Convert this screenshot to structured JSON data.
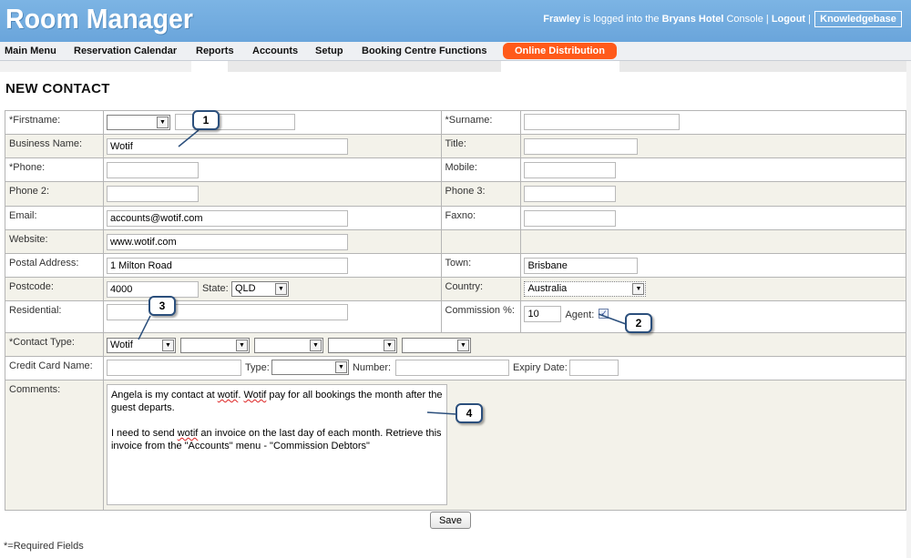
{
  "app": {
    "logo": "Room Manager",
    "user_name": "Frawley",
    "user_mid": " is logged into the ",
    "hotel_name": "Bryans Hotel",
    "user_tail": " Console | ",
    "logout": "Logout",
    "sep": " |",
    "knowledgebase": "Knowledgebase"
  },
  "nav": {
    "items": [
      "Main Menu",
      "Reservation Calendar",
      "Reports",
      "Accounts",
      "Setup",
      "Booking Centre Functions"
    ],
    "online": "Online Distribution"
  },
  "page": {
    "title": "NEW CONTACT"
  },
  "form": {
    "firstname_label": "*Firstname:",
    "surname_label": "*Surname:",
    "business_label": "Business Name:",
    "business_value": "Wotif",
    "title_label": "Title:",
    "phone_label": "*Phone:",
    "mobile_label": "Mobile:",
    "phone2_label": "Phone 2:",
    "phone3_label": "Phone 3:",
    "email_label": "Email:",
    "email_value": "accounts@wotif.com",
    "faxno_label": "Faxno:",
    "website_label": "Website:",
    "website_value": "www.wotif.com",
    "postal_label": "Postal Address:",
    "postal_value": "1 Milton Road",
    "town_label": "Town:",
    "town_value": "Brisbane",
    "postcode_label": "Postcode:",
    "postcode_value": "4000",
    "state_label": "State:",
    "state_value": "QLD",
    "country_label": "Country:",
    "country_value": "Australia",
    "residential_label": "Residential:",
    "commission_label": "Commission %:",
    "commission_value": "10",
    "agent_label": "Agent:",
    "agent_checked": "✓",
    "contact_type_label": "*Contact Type:",
    "contact_type_value": "Wotif",
    "cc_name_label": "Credit Card Name:",
    "cc_type_label": "Type:",
    "cc_number_label": "Number:",
    "cc_expiry_label": "Expiry Date:",
    "comments_label": "Comments:",
    "comments_p1_a": "Angela is my contact at ",
    "comments_p1_b": "wotif",
    "comments_p1_c": ". ",
    "comments_p1_d": "Wotif",
    "comments_p1_e": " pay for all bookings the month after the guest departs.",
    "comments_p2_a": "I need to send ",
    "comments_p2_b": "wotif",
    "comments_p2_c": " an invoice on the last day of each month. Retrieve this invoice from the \"Accounts\" menu - \"Commission Debtors\""
  },
  "actions": {
    "save": "Save"
  },
  "footer": {
    "required_note": "*=Required Fields"
  },
  "callouts": [
    "1",
    "2",
    "3",
    "4"
  ],
  "icons": {
    "dropdown": "chevron-down-icon",
    "checkbox": "checkmark-icon"
  },
  "colors": {
    "header": "#6aa5db",
    "online_tab": "#ff5a1a",
    "callout_border": "#2b4f7c",
    "alt_row": "#f3f2ea"
  }
}
